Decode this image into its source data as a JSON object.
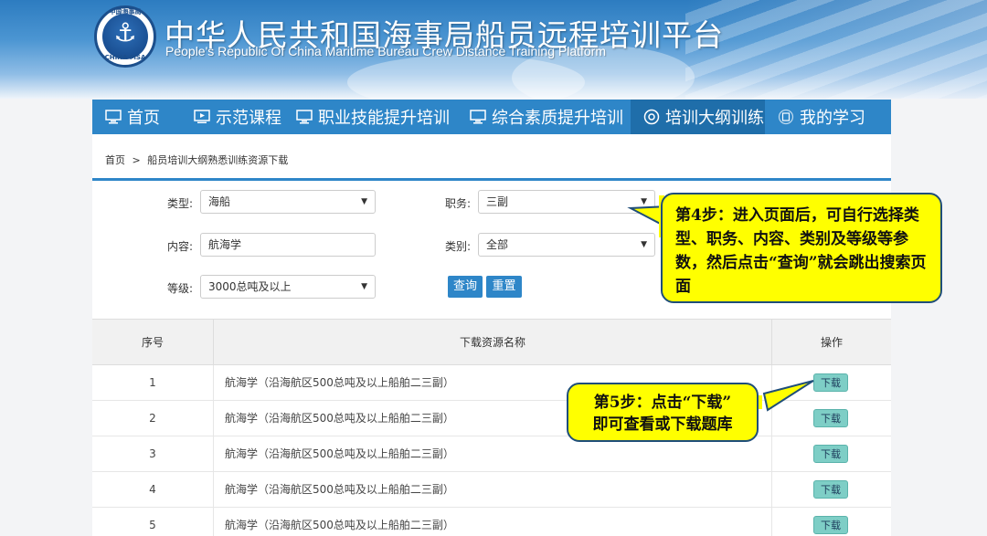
{
  "header": {
    "logo_cn": "中国海事局",
    "logo_en": "CHINA MSA",
    "title_cn": "中华人民共和国海事局船员远程培训平台",
    "title_en": "People's Republic Of China Maritime Bureau Crew Distance Training Platform"
  },
  "nav": {
    "items": [
      {
        "label": "首页",
        "icon": "monitor-icon"
      },
      {
        "label": "示范课程",
        "icon": "video-icon"
      },
      {
        "label": "职业技能提升培训",
        "icon": "monitor-icon"
      },
      {
        "label": "综合素质提升培训",
        "icon": "monitor-icon"
      },
      {
        "label": "培训大纲训练",
        "icon": "target-icon",
        "active": true
      },
      {
        "label": "我的学习",
        "icon": "book-icon"
      }
    ]
  },
  "breadcrumb": {
    "home": "首页",
    "sep": ">",
    "current": "船员培训大纲熟悉训练资源下载"
  },
  "filters": {
    "type_label": "类型:",
    "type_value": "海船",
    "position_label": "职务:",
    "position_value": "三副",
    "content_label": "内容:",
    "content_value": "航海学",
    "category_label": "类别:",
    "category_value": "全部",
    "grade_label": "等级:",
    "grade_value": "3000总吨及以上",
    "query_button": "查询",
    "reset_button": "重置"
  },
  "table": {
    "headers": [
      "序号",
      "下载资源名称",
      "操作"
    ],
    "rows": [
      {
        "no": "1",
        "name": "航海学（沿海航区500总吨及以上船舶二三副）",
        "action": "下载"
      },
      {
        "no": "2",
        "name": "航海学（沿海航区500总吨及以上船舶二三副）",
        "action": "下载"
      },
      {
        "no": "3",
        "name": "航海学（沿海航区500总吨及以上船舶二三副）",
        "action": "下载"
      },
      {
        "no": "4",
        "name": "航海学（沿海航区500总吨及以上船舶二三副）",
        "action": "下载"
      },
      {
        "no": "5",
        "name": "航海学（沿海航区500总吨及以上船舶二三副）",
        "action": "下载"
      }
    ]
  },
  "callouts": {
    "step4": "第4步：进入页面后，可自行选择类型、职务、内容、类别及等级等参数，然后点击“查询”就会跳出搜索页面",
    "step5_line1": "第5步：点击“下载”",
    "step5_line2": "即可查看或下载题库"
  },
  "colors": {
    "nav_bg": "#2e86c8",
    "nav_active": "#1f6eaa",
    "callout_bg": "#ffff00",
    "download_btn": "#7ecec6"
  }
}
